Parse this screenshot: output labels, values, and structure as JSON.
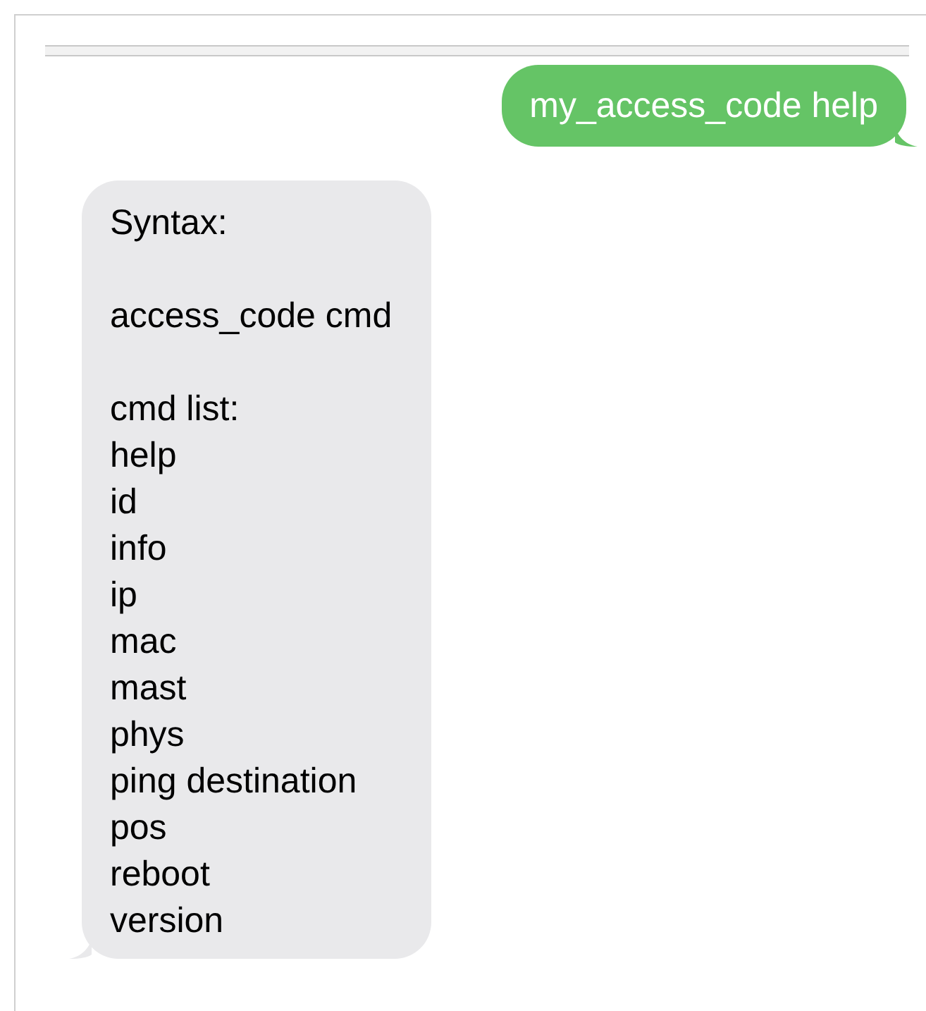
{
  "messages": [
    {
      "kind": "sent",
      "paragraphs": [
        [
          "my_access_code help"
        ]
      ]
    },
    {
      "kind": "received",
      "paragraphs": [
        [
          "Syntax:"
        ],
        [
          "access_code cmd"
        ],
        [
          "cmd list:",
          "help",
          "id",
          "info",
          "ip",
          "mac",
          "mast",
          "phys",
          "ping destination",
          "pos",
          "reboot",
          "version"
        ]
      ]
    }
  ]
}
